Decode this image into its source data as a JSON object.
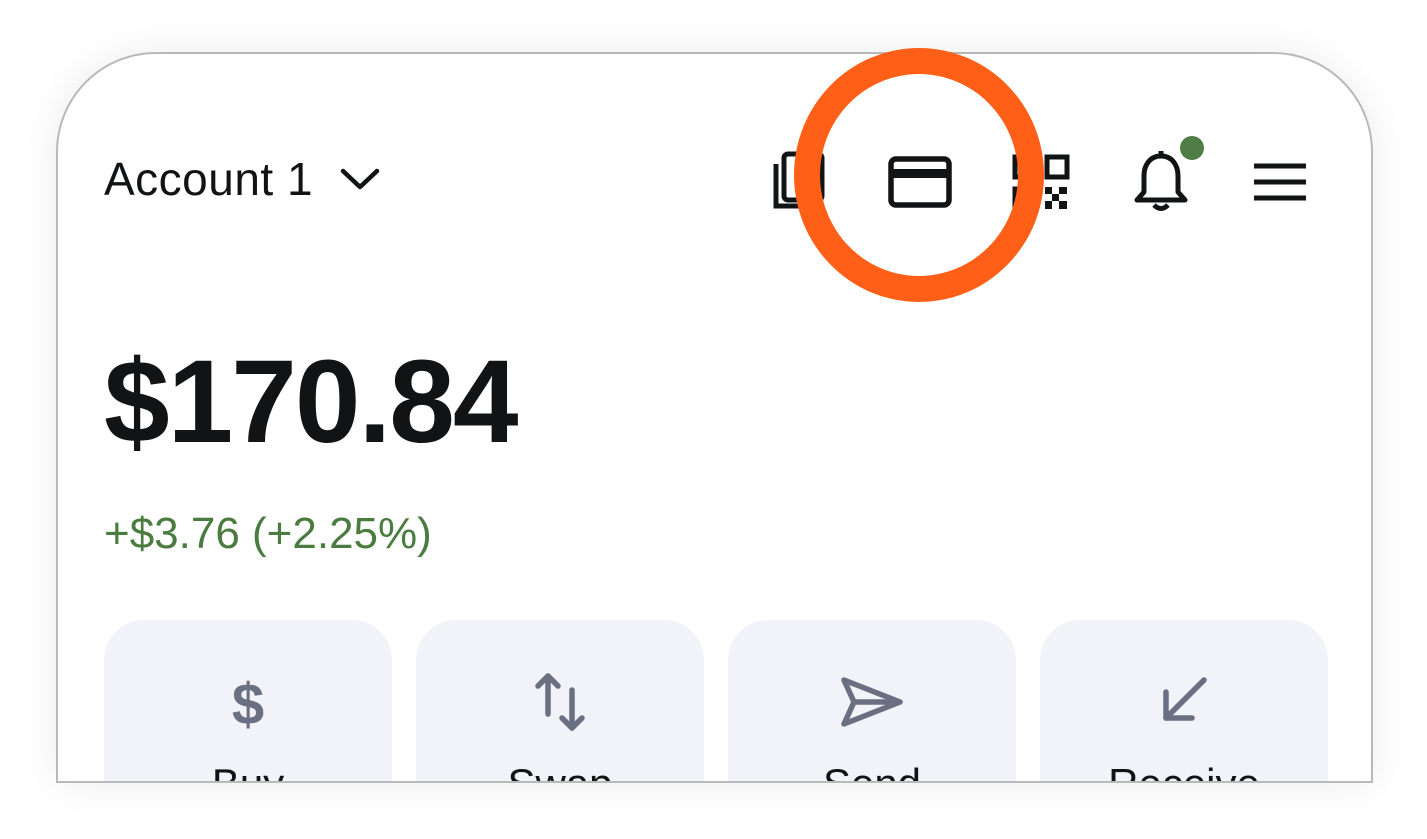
{
  "header": {
    "account_name": "Account 1",
    "icons": [
      "copy-icon",
      "card-icon",
      "qr-code-icon",
      "bell-icon",
      "menu-icon"
    ],
    "notification_dot_color": "#4f7d45"
  },
  "balance": {
    "total": "$170.84",
    "change": "+$3.76 (+2.25%)",
    "change_color": "#4a7c3f"
  },
  "actions": [
    {
      "label": "Buy",
      "icon": "dollar-icon"
    },
    {
      "label": "Swap",
      "icon": "swap-arrows-icon"
    },
    {
      "label": "Send",
      "icon": "send-icon"
    },
    {
      "label": "Receive",
      "icon": "receive-arrow-icon"
    }
  ],
  "highlight": {
    "target": "card-icon",
    "color": "#ff5f17"
  }
}
